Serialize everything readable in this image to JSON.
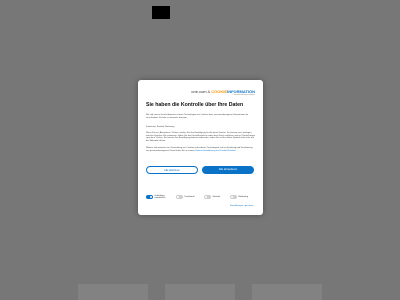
{
  "modal": {
    "brand": {
      "one": "one.com",
      "amp": "&",
      "cookie": "COOKIE",
      "information": "INFORMATION",
      "sub": "Cookie-Einstellungen verwalten"
    },
    "title": "Sie haben die Kontrolle über Ihre Daten",
    "intro": "Wir und unsere Geschäftspartner nutzen Technologien wie Cookies dazu, personenbezogene Informationen für verschiedene Zwecke zu sammeln, darunter:",
    "purposes": "Funktional, Statistik, Marketing",
    "body": "Wenn Sie auf „Akzeptieren“ klicken, erteilen Sie Ihre Einwilligung für alle diese Zwecke. Sie können auch festlegen, welchen Zwecken Sie zustimmen, indem Sie das Kontrollkästchen neben dem Zweck anklicken und auf „Einstellungen speichern“ klicken. Sie können Ihre Einwilligung jederzeit widerrufen, indem Sie auf das kleine Symbol unten links auf der Webseite klicken.",
    "more_prefix": "Weitere Informationen zur Verwendung von Cookies und anderen Technologien und zur Erhebung und Verarbeitung von personenbezogenen Daten finden Sie in unserer",
    "more_link": "Datenschutzerklärung und Cookie-Richtlinie",
    "buttons": {
      "reject": "Alle ablehnen",
      "accept": "Alle akzeptieren"
    },
    "toggles": [
      {
        "label": "Unbedingt erforderlich",
        "on": true
      },
      {
        "label": "Funktional",
        "on": false
      },
      {
        "label": "Statistik",
        "on": false
      },
      {
        "label": "Marketing",
        "on": false
      }
    ],
    "save_settings": "Einstellungen speichern"
  },
  "colors": {
    "accent": "#0a73c8",
    "cookie": "#f39200",
    "overlay": "#777777"
  }
}
